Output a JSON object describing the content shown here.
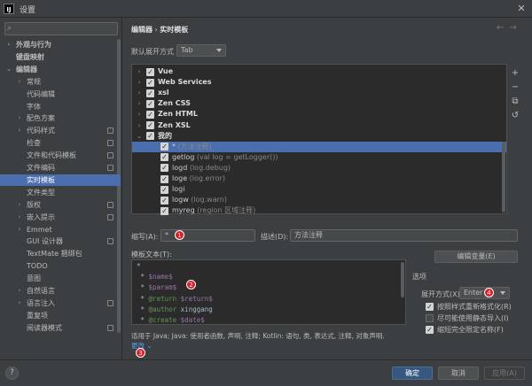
{
  "window": {
    "title": "设置",
    "logo": "IJ",
    "close": "✕"
  },
  "search": {
    "placeholder": ""
  },
  "sidebar": {
    "items": [
      {
        "label": "外观与行为",
        "chevron": "›",
        "bold": true,
        "level": 0,
        "selected": false,
        "badge": false
      },
      {
        "label": "键盘映射",
        "chevron": "",
        "bold": true,
        "level": 0,
        "selected": false,
        "badge": false
      },
      {
        "label": "编辑器",
        "chevron": "⌄",
        "bold": true,
        "level": 0,
        "selected": false,
        "badge": false
      },
      {
        "label": "常规",
        "chevron": "›",
        "bold": false,
        "level": 1,
        "selected": false,
        "badge": false
      },
      {
        "label": "代码编辑",
        "chevron": "",
        "bold": false,
        "level": 1,
        "selected": false,
        "badge": false
      },
      {
        "label": "字体",
        "chevron": "",
        "bold": false,
        "level": 1,
        "selected": false,
        "badge": false
      },
      {
        "label": "配色方案",
        "chevron": "›",
        "bold": false,
        "level": 1,
        "selected": false,
        "badge": false
      },
      {
        "label": "代码样式",
        "chevron": "›",
        "bold": false,
        "level": 1,
        "selected": false,
        "badge": true
      },
      {
        "label": "检查",
        "chevron": "",
        "bold": false,
        "level": 1,
        "selected": false,
        "badge": true
      },
      {
        "label": "文件和代码模板",
        "chevron": "",
        "bold": false,
        "level": 1,
        "selected": false,
        "badge": true
      },
      {
        "label": "文件编码",
        "chevron": "",
        "bold": false,
        "level": 1,
        "selected": false,
        "badge": true
      },
      {
        "label": "实时模板",
        "chevron": "",
        "bold": false,
        "level": 1,
        "selected": true,
        "badge": false
      },
      {
        "label": "文件类型",
        "chevron": "",
        "bold": false,
        "level": 1,
        "selected": false,
        "badge": false
      },
      {
        "label": "版权",
        "chevron": "›",
        "bold": false,
        "level": 1,
        "selected": false,
        "badge": true
      },
      {
        "label": "嵌入提示",
        "chevron": "›",
        "bold": false,
        "level": 1,
        "selected": false,
        "badge": true
      },
      {
        "label": "Emmet",
        "chevron": "›",
        "bold": false,
        "level": 1,
        "selected": false,
        "badge": false
      },
      {
        "label": "GUI 设计器",
        "chevron": "",
        "bold": false,
        "level": 1,
        "selected": false,
        "badge": true
      },
      {
        "label": "TextMate 捆绑包",
        "chevron": "",
        "bold": false,
        "level": 1,
        "selected": false,
        "badge": false
      },
      {
        "label": "TODO",
        "chevron": "",
        "bold": false,
        "level": 1,
        "selected": false,
        "badge": false
      },
      {
        "label": "意图",
        "chevron": "",
        "bold": false,
        "level": 1,
        "selected": false,
        "badge": false
      },
      {
        "label": "自然语言",
        "chevron": "›",
        "bold": false,
        "level": 1,
        "selected": false,
        "badge": false
      },
      {
        "label": "语言注入",
        "chevron": "›",
        "bold": false,
        "level": 1,
        "selected": false,
        "badge": true
      },
      {
        "label": "重复项",
        "chevron": "",
        "bold": false,
        "level": 1,
        "selected": false,
        "badge": false
      },
      {
        "label": "阅读器模式",
        "chevron": "",
        "bold": false,
        "level": 1,
        "selected": false,
        "badge": true
      }
    ]
  },
  "breadcrumb": {
    "parent": "编辑器",
    "sep": "›",
    "current": "实时模板"
  },
  "nav": {
    "back": "←",
    "forward": "→"
  },
  "expand": {
    "label": "默认展开方式",
    "value": "Tab"
  },
  "templates": [
    {
      "type": "group",
      "name": "Vue",
      "expanded": false,
      "checked": true,
      "desc": "",
      "selected": false
    },
    {
      "type": "group",
      "name": "Web Services",
      "expanded": false,
      "checked": true,
      "desc": "",
      "selected": false
    },
    {
      "type": "group",
      "name": "xsl",
      "expanded": false,
      "checked": true,
      "desc": "",
      "selected": false
    },
    {
      "type": "group",
      "name": "Zen CSS",
      "expanded": false,
      "checked": true,
      "desc": "",
      "selected": false
    },
    {
      "type": "group",
      "name": "Zen HTML",
      "expanded": false,
      "checked": true,
      "desc": "",
      "selected": false
    },
    {
      "type": "group",
      "name": "Zen XSL",
      "expanded": false,
      "checked": true,
      "desc": "",
      "selected": false
    },
    {
      "type": "group",
      "name": "我的",
      "expanded": true,
      "checked": true,
      "desc": "",
      "selected": false
    },
    {
      "type": "item",
      "name": "*",
      "expanded": false,
      "checked": true,
      "desc": "(方法注释)",
      "selected": true
    },
    {
      "type": "item",
      "name": "getlog",
      "expanded": false,
      "checked": true,
      "desc": "(val log = getLogger())",
      "selected": false
    },
    {
      "type": "item",
      "name": "logd",
      "expanded": false,
      "checked": true,
      "desc": "(log.debug)",
      "selected": false
    },
    {
      "type": "item",
      "name": "loge",
      "expanded": false,
      "checked": true,
      "desc": "(log.error)",
      "selected": false
    },
    {
      "type": "item",
      "name": "logi",
      "expanded": false,
      "checked": true,
      "desc": "",
      "selected": false
    },
    {
      "type": "item",
      "name": "logw",
      "expanded": false,
      "checked": true,
      "desc": "(log.warn)",
      "selected": false
    },
    {
      "type": "item",
      "name": "myreg",
      "expanded": false,
      "checked": true,
      "desc": "(region 区域注释)",
      "selected": false
    }
  ],
  "side_buttons": [
    "+",
    "−",
    "⧉",
    "↺"
  ],
  "abbrev": {
    "label": "缩写(A):",
    "value": "*",
    "marker": "1"
  },
  "description": {
    "label": "描述(D):",
    "value": "方法注释"
  },
  "template_text": {
    "label": "模板文本(T):",
    "marker": "2"
  },
  "edit_vars": {
    "label": "编辑变量(E)"
  },
  "code_lines": [
    [
      {
        "t": "*",
        "c": ""
      }
    ],
    [
      {
        "t": " * ",
        "c": ""
      },
      {
        "t": "$name$",
        "c": "var"
      }
    ],
    [
      {
        "t": " * ",
        "c": ""
      },
      {
        "t": "$param$",
        "c": "var"
      }
    ],
    [
      {
        "t": " * ",
        "c": ""
      },
      {
        "t": "@return",
        "c": "tag"
      },
      {
        "t": " ",
        "c": ""
      },
      {
        "t": "$return$",
        "c": "var"
      }
    ],
    [
      {
        "t": " * ",
        "c": ""
      },
      {
        "t": "@author",
        "c": "tag"
      },
      {
        "t": " xinggang",
        "c": ""
      }
    ],
    [
      {
        "t": " * ",
        "c": ""
      },
      {
        "t": "@create",
        "c": "tag"
      },
      {
        "t": " ",
        "c": ""
      },
      {
        "t": "$date$",
        "c": "var"
      }
    ]
  ],
  "options": {
    "label": "选项",
    "expand_label": "展开方式(X)",
    "expand_value": "Enter",
    "marker": "4",
    "checks": [
      {
        "label": "按照样式重新格式化(R)",
        "checked": true
      },
      {
        "label": "尽可能使用静态导入(I)",
        "checked": false
      },
      {
        "label": "缩短完全限定名称(F)",
        "checked": true
      }
    ]
  },
  "context": {
    "text": "适用于 Java; Java: 使用者函数, 声明, 注释; Kotlin: 语句, 类, 表达式, 注释, 对象声明."
  },
  "change": {
    "label": "更改",
    "chevron": "⌄",
    "marker": "3"
  },
  "footer": {
    "help": "?",
    "ok": "确定",
    "cancel": "取消",
    "apply": "应用(A)"
  }
}
